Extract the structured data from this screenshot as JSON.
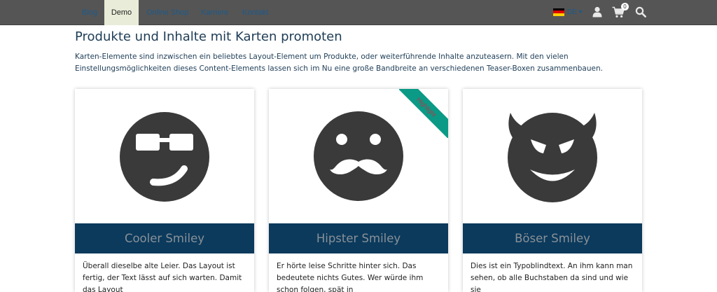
{
  "navbar": {
    "items": [
      {
        "label": "Blog"
      },
      {
        "label": "Demo",
        "active": true
      },
      {
        "label": "Online Shop"
      },
      {
        "label": "Karriere"
      },
      {
        "label": "Kontakt"
      }
    ],
    "language": {
      "label": "DE",
      "flag_colors": [
        "#000000",
        "#dd0000",
        "#ffce00"
      ]
    },
    "cart_count": "0",
    "icons": [
      "user-icon",
      "cart-icon",
      "search-icon"
    ]
  },
  "main": {
    "title": "Produkte und Inhalte mit Karten promoten",
    "intro": "Karten-Elemente sind inzwischen ein beliebtes Layout-Element um Produkte, oder weiterführende Inhalte anzuteasern. Mit den vielen Einstellungsmöglichkeiten dieses Content-Elements lassen sich im Nu eine große Bandbreite an verschiedenen Teaser-Boxen zusammenbauen."
  },
  "cards": [
    {
      "title": "Cooler Smiley",
      "text": "Überall dieselbe alte Leier. Das Layout ist fertig, der Text lässt auf sich warten. Damit das Layout",
      "icon": "cool-smiley-icon"
    },
    {
      "title": "Hipster Smiley",
      "text": "Er hörte leise Schritte hinter sich. Das bedeutete nichts Gutes. Wer würde ihm schon folgen, spät in",
      "icon": "hipster-smiley-icon",
      "ribbon": "Highlight"
    },
    {
      "title": "Böser Smiley",
      "text": "Dies ist ein Typoblindtext. An ihm kann man sehen, ob alle Buchstaben da sind und wie sie",
      "icon": "evil-smiley-icon"
    }
  ],
  "colors": {
    "navbar_bg": "#555555",
    "nav_link": "#1d5a8a",
    "active_tab_bg": "#e9ecd8",
    "card_title_bar": "#0b3a5c",
    "ribbon": "#0a9a86",
    "smiley_fill": "#3a3a3a"
  }
}
